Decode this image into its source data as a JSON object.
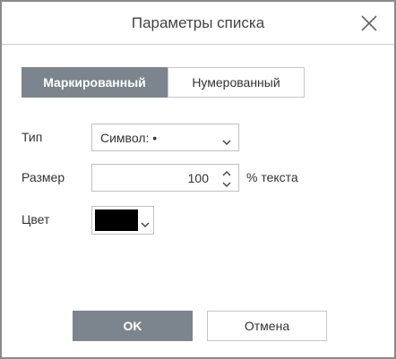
{
  "dialog": {
    "title": "Параметры списка"
  },
  "tabs": {
    "bulleted": "Маркированный",
    "numbered": "Нумерованный"
  },
  "form": {
    "type_label": "Тип",
    "type_value": "Символ: •",
    "size_label": "Размер",
    "size_value": "100",
    "size_unit": "% текста",
    "color_label": "Цвет",
    "color_value": "#000000"
  },
  "buttons": {
    "ok": "OK",
    "cancel": "Отмена"
  },
  "icons": {
    "close": "close-icon",
    "dropdown": "chevron-down-icon",
    "spin_up": "chevron-up-icon",
    "spin_down": "chevron-down-icon"
  },
  "colors": {
    "accent": "#7c858d",
    "border": "#c0c0c0"
  }
}
